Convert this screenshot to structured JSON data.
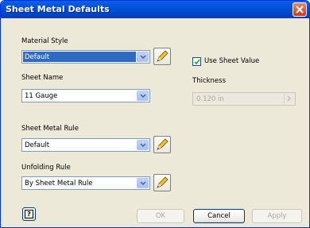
{
  "window": {
    "title": "Sheet Metal Defaults"
  },
  "material_style": {
    "label": "Material Style",
    "value": "Default"
  },
  "sheet_name": {
    "label": "Sheet Name",
    "value": "11 Gauge"
  },
  "sheet_metal_rule": {
    "label": "Sheet Metal Rule",
    "value": "Default"
  },
  "unfolding_rule": {
    "label": "Unfolding Rule",
    "value": "By Sheet Metal Rule"
  },
  "use_sheet_value": {
    "label": "Use Sheet Value",
    "checked": true
  },
  "thickness": {
    "label": "Thickness",
    "value": "0.120 in"
  },
  "buttons": {
    "ok": "OK",
    "cancel": "Cancel",
    "apply": "Apply",
    "help": "?"
  },
  "colors": {
    "title_bar": "#0050d8",
    "dialog_bg": "#ece9d8",
    "selection": "#316ac5"
  }
}
